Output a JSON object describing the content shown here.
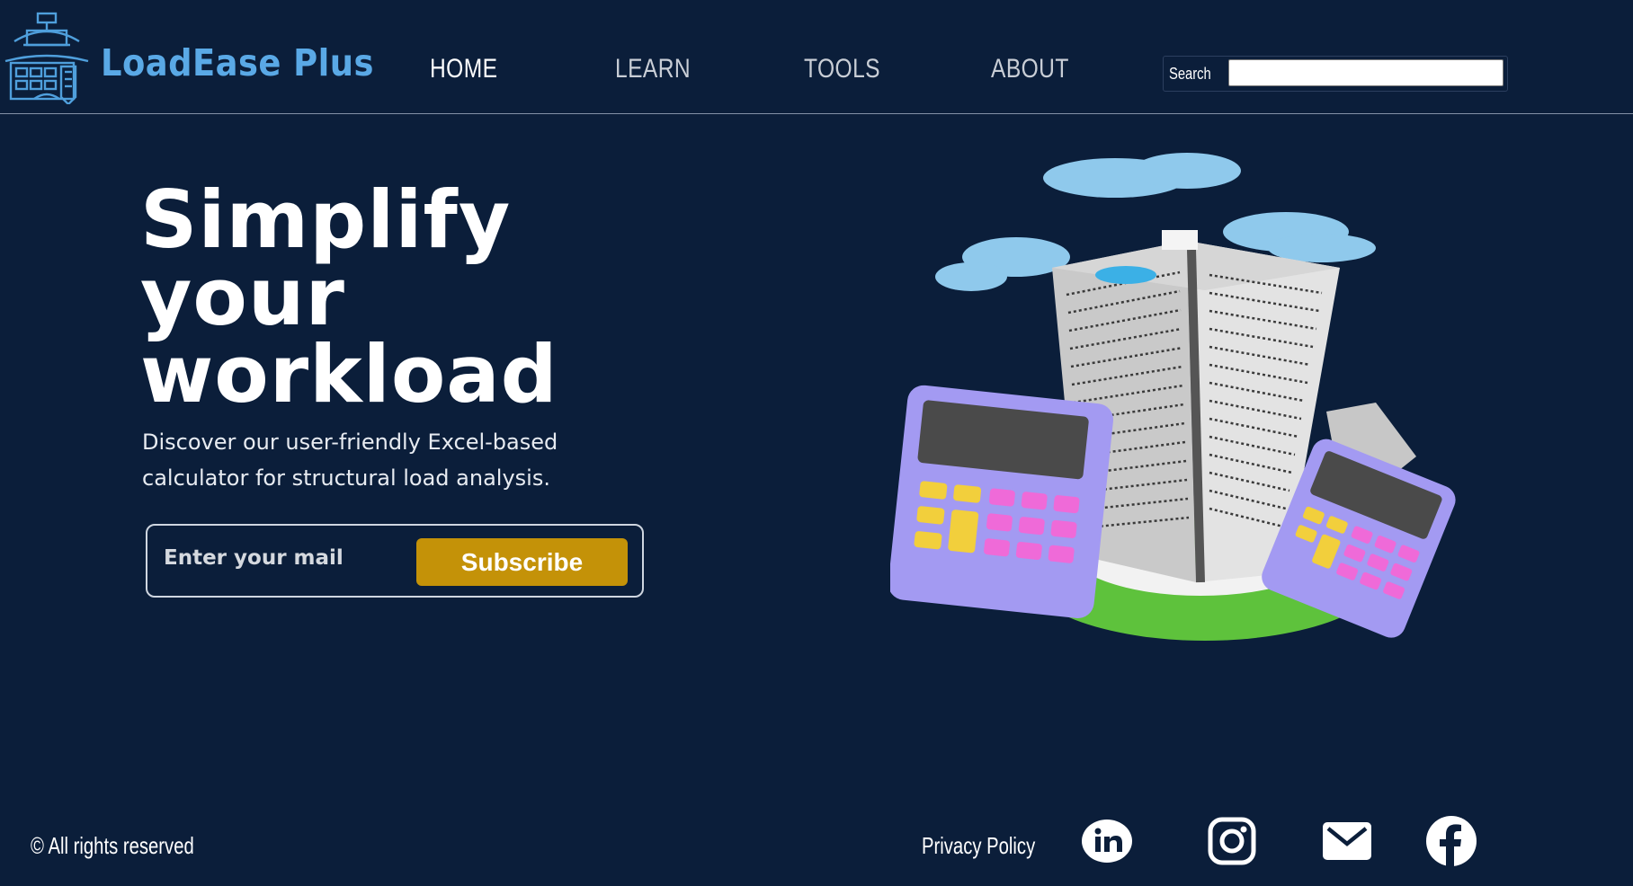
{
  "header": {
    "brand": "LoadEase Plus",
    "logo_icon": "bridge-building-logo-icon",
    "nav": [
      {
        "label": "HOME",
        "active": true
      },
      {
        "label": "LEARN",
        "active": false
      },
      {
        "label": "TOOLS",
        "active": false
      },
      {
        "label": "ABOUT",
        "active": false
      }
    ],
    "search": {
      "label": "Search",
      "value": ""
    }
  },
  "hero": {
    "title_lines": [
      "Simplify",
      "your",
      "workload"
    ],
    "subtitle_lines": [
      "Discover our user-friendly Excel-based",
      "calculator for structural load analysis."
    ],
    "email_placeholder": "Enter your mail",
    "subscribe_label": "Subscribe",
    "illustration": "skyscraper-with-calculators-illustration"
  },
  "footer": {
    "copyright": "© All rights reserved",
    "privacy": "Privacy Policy",
    "social": [
      "linkedin-icon",
      "instagram-icon",
      "mail-icon",
      "facebook-icon"
    ]
  },
  "colors": {
    "background": "#0b1e3a",
    "brand": "#5aa9e6",
    "button": "#c49208",
    "text": "#ffffff"
  }
}
